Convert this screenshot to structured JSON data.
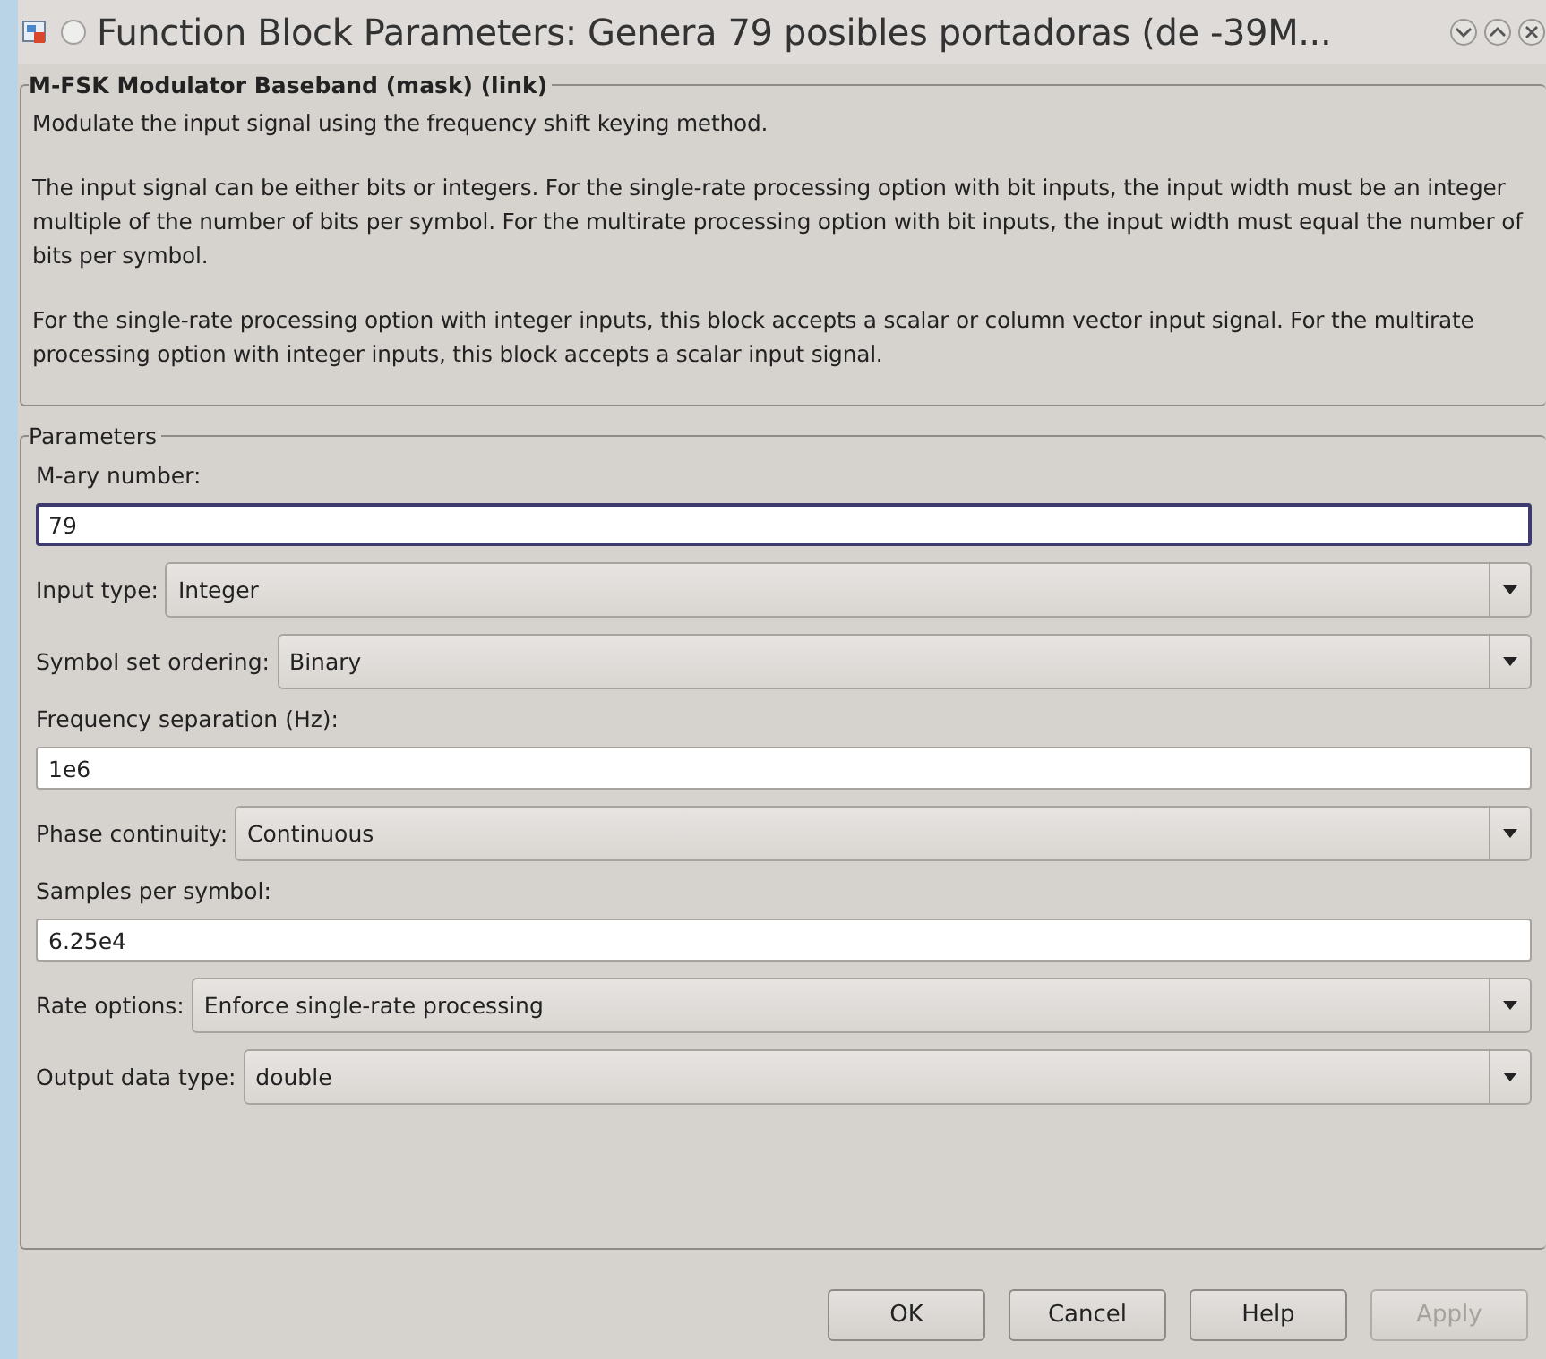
{
  "window": {
    "title": "Function Block Parameters: Genera 79 posibles portadoras (de -39M..."
  },
  "description": {
    "title": "M-FSK Modulator Baseband (mask) (link)",
    "paragraphs": [
      "Modulate the input signal using the frequency shift keying method.",
      "The input signal can be either bits or integers.  For the single-rate processing option with bit inputs, the input width must be an integer multiple of the number of bits per symbol.  For the multirate processing option with bit inputs, the input width must equal the number of bits per symbol.",
      "For the single-rate processing option with integer inputs, this block accepts a scalar or column vector input signal.  For the multirate processing option with integer inputs, this block accepts a scalar input signal."
    ]
  },
  "parameters": {
    "title": "Parameters",
    "fields": [
      {
        "kind": "edit",
        "label": "M-ary number:",
        "value": "79",
        "focused": true
      },
      {
        "kind": "popup",
        "label": "Input type:",
        "value": "Integer"
      },
      {
        "kind": "popup",
        "label": "Symbol set ordering:",
        "value": "Binary"
      },
      {
        "kind": "edit",
        "label": "Frequency separation (Hz):",
        "value": "1e6",
        "focused": false
      },
      {
        "kind": "popup",
        "label": "Phase continuity:",
        "value": "Continuous"
      },
      {
        "kind": "edit",
        "label": "Samples per symbol:",
        "value": "6.25e4",
        "focused": false
      },
      {
        "kind": "popup",
        "label": "Rate options:",
        "value": "Enforce single-rate processing"
      },
      {
        "kind": "popup",
        "label": "Output data type:",
        "value": "double"
      }
    ]
  },
  "buttons": [
    {
      "label": "OK",
      "disabled": false
    },
    {
      "label": "Cancel",
      "disabled": false
    },
    {
      "label": "Help",
      "disabled": false
    },
    {
      "label": "Apply",
      "disabled": true
    }
  ]
}
